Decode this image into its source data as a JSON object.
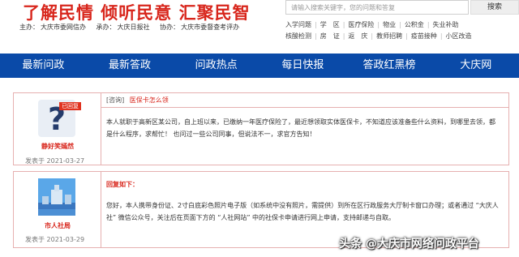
{
  "header": {
    "slogan": "了解民情 倾听民意 汇聚民智",
    "sponsors": [
      {
        "label": "主办：",
        "value": "大庆市委网信办"
      },
      {
        "label": "承办：",
        "value": "大庆日报社"
      },
      {
        "label": "协办：",
        "value": "大庆市委督查考评办"
      }
    ],
    "search": {
      "placeholder": "请输入搜索关键字，您的问题和答复",
      "button_label": "搜索"
    },
    "tags_row1": [
      "入学问题",
      "学",
      "区",
      "医疗保险",
      "物业",
      "公积金",
      "失业补助"
    ],
    "tags_row2": [
      "核酸检测",
      "房",
      "证",
      "返",
      "庆",
      "教师招聘",
      "疫苗接种",
      "小区改造"
    ]
  },
  "nav": {
    "items": [
      "最新问政",
      "最新答政",
      "问政热点",
      "每日快报",
      "答政红黑榜",
      "大庆网"
    ]
  },
  "question": {
    "user_name": "静好笑嫣然",
    "badge": "已回复",
    "date": "发表于 2021-03-27",
    "tag": "[咨询]",
    "title": "医保卡怎么领",
    "body": "本人就职于高新区某公司，自上班以来，已缴纳一年医疗保险了，最近想领取实体医保卡，不知道应该准备些什么资料，到哪里去领，都是什么程序，求帮忙！ 也问过一些公司同事，但说法不一，求官方告知！"
  },
  "answer": {
    "user_name": "市人社局",
    "date": "发表于 2021-03-29",
    "heading": "回复如下：",
    "body": "您好，本人携带身份证、2寸白底彩色照片电子版（如系统中没有照片，需提供）到所在区行政服务大厅制卡窗口办理；或者通过 “大庆人社” 微信公众号，关注后在页面下方的 “人社网站” 中的社保卡申请进行网上申请，支持邮递与自取。"
  },
  "watermark": "头条 @大庆市网络问政平台",
  "colors": {
    "brand_red": "#d8261c",
    "nav_blue": "#0a4aa8",
    "card_border": "#e6b0b0"
  }
}
